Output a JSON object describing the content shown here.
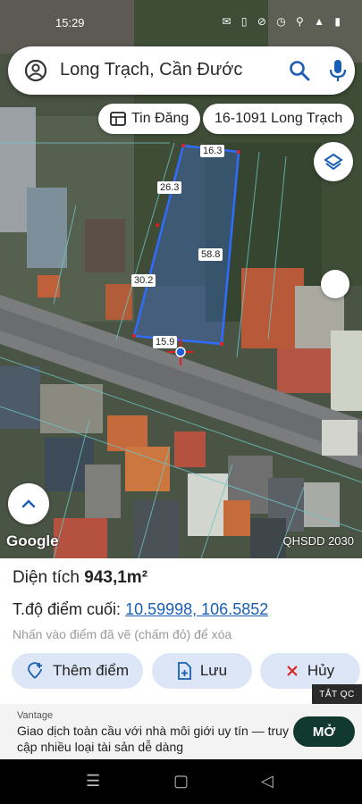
{
  "status": {
    "time": "15:29",
    "icons": "✉ ▯ ⊘ ◷ ⚲ ▲ ▮"
  },
  "search": {
    "query": "Long Trạch, Cần Đước"
  },
  "chips": {
    "listings": "Tin Đăng",
    "parcel": "16-1091 Long Trạch"
  },
  "measurements": {
    "top": "16.3",
    "upper_left": "26.3",
    "right": "58.8",
    "left": "30.2",
    "bottom": "15.9"
  },
  "map": {
    "provider": "Google",
    "plan_label": "QHSDD 2030"
  },
  "sheet": {
    "area_label": "Diện tích",
    "area_value": "943,1m²",
    "coord_label": "T.độ điểm cuối:",
    "coord_value": "10.59998, 106.5852",
    "hint": "Nhấn vào điểm đã vẽ (chấm đỏ) để xóa",
    "add_button": "Thêm điểm",
    "save_button": "Lưu",
    "cancel_button": "Hủy"
  },
  "ad": {
    "close_label": "TẮT QC",
    "brand": "Vantage",
    "text": "Giao dịch toàn cầu với nhà môi giới uy tín — truy cập nhiều loại tài sản dễ dàng",
    "cta": "MỞ"
  },
  "nav": {
    "recents": "☰",
    "home": "▢",
    "back": "◁"
  },
  "colors": {
    "accent": "#1a5fb4",
    "polygon": "#2f6cff",
    "button_bg": "#dde6f6",
    "ad_cta": "#12392f"
  }
}
